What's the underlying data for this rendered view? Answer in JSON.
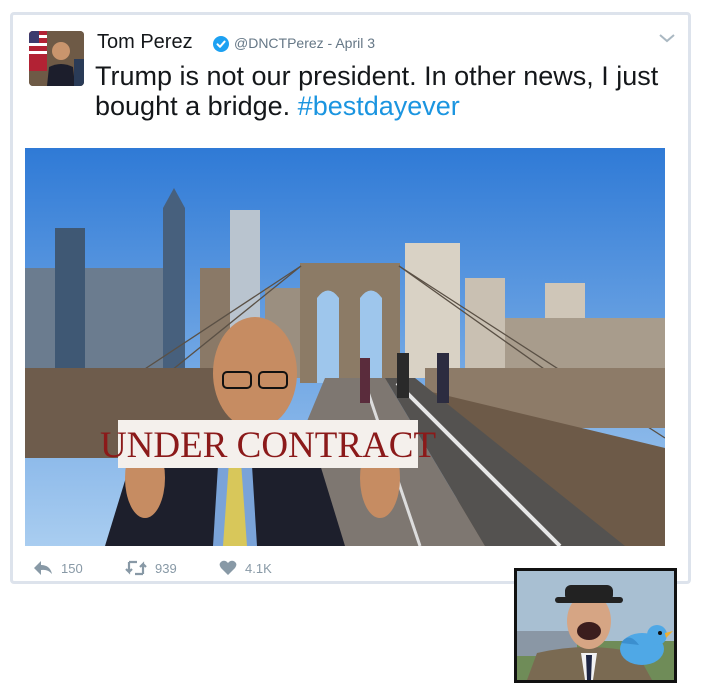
{
  "tweet": {
    "author_name": "Tom Perez",
    "handle_date": "@DNCTPerez - April 3",
    "text_main": "Trump is not our president.  In other news, I just bought a bridge. ",
    "hashtag": "#bestdayever",
    "media": {
      "sign_text": "UNDER CONTRACT"
    },
    "actions": {
      "reply_count": "150",
      "retweet_count": "939",
      "like_count": "4.1K"
    }
  },
  "icons": [
    "verified-badge-icon",
    "chevron-down-icon",
    "reply-icon",
    "retweet-icon",
    "like-icon",
    "twitter-bird-icon"
  ],
  "colors": {
    "hashtag": "#1b95e0",
    "verified": "#1da1f2",
    "muted": "#8899a6"
  }
}
